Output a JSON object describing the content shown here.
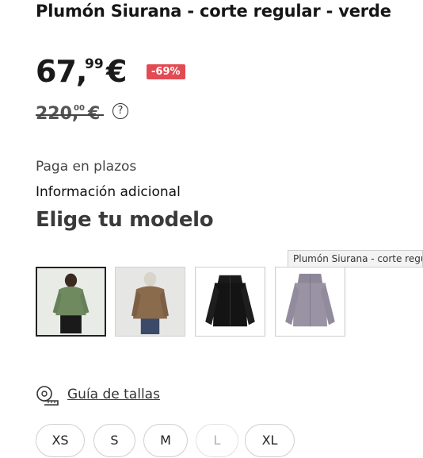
{
  "product": {
    "title": "Plumón Siurana - corte regular - verde"
  },
  "price": {
    "current_int": "67,",
    "current_cents": "99",
    "currency": "€",
    "discount": "-69%",
    "old_int": "220,",
    "old_cents": "00",
    "old_currency": "€",
    "help_symbol": "?"
  },
  "links": {
    "installments": "Paga en plazos",
    "additional_info": "Información adicional"
  },
  "model_section": {
    "title": "Elige tu modelo",
    "tooltip": "Plumón Siurana - corte regular",
    "variants": [
      {
        "color_name": "green",
        "jacket_color": "#6f8a5e",
        "selected": true
      },
      {
        "color_name": "brown",
        "jacket_color": "#8a6b4c",
        "selected": false
      },
      {
        "color_name": "black",
        "jacket_color": "#141414",
        "selected": false
      },
      {
        "color_name": "lilac",
        "jacket_color": "#9a93a4",
        "selected": false
      }
    ]
  },
  "size_guide": {
    "label": "Guía de tallas",
    "icon": "measuring-tape-icon"
  },
  "sizes": [
    {
      "label": "XS",
      "available": true
    },
    {
      "label": "S",
      "available": true
    },
    {
      "label": "M",
      "available": true
    },
    {
      "label": "L",
      "available": false
    },
    {
      "label": "XL",
      "available": true
    }
  ],
  "colors": {
    "discount_badge": "#e24b53",
    "text": "#1a1a1a"
  }
}
